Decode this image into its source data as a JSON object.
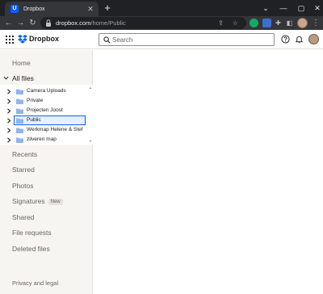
{
  "browser": {
    "tab_title": "Dropbox",
    "tab_favicon_letter": "U",
    "url_host": "dropbox.com",
    "url_path": "/home/Public",
    "accent_color": "#0061fe"
  },
  "header": {
    "brand": "Dropbox",
    "search_placeholder": "Search"
  },
  "sidebar": {
    "home": "Home",
    "all_files": "All files",
    "tree": [
      {
        "label": "Camera Uploads",
        "selected": false
      },
      {
        "label": "Private",
        "selected": false
      },
      {
        "label": "Projecten Joost",
        "selected": false
      },
      {
        "label": "Public",
        "selected": true
      },
      {
        "label": "Werkmap Helene & Stef",
        "selected": false
      },
      {
        "label": "zilveren map",
        "selected": false
      }
    ],
    "recents": "Recents",
    "starred": "Starred",
    "photos": "Photos",
    "signatures": "Signatures",
    "signatures_badge": "New",
    "shared": "Shared",
    "file_requests": "File requests",
    "deleted_files": "Deleted files",
    "privacy": "Privacy and legal"
  }
}
